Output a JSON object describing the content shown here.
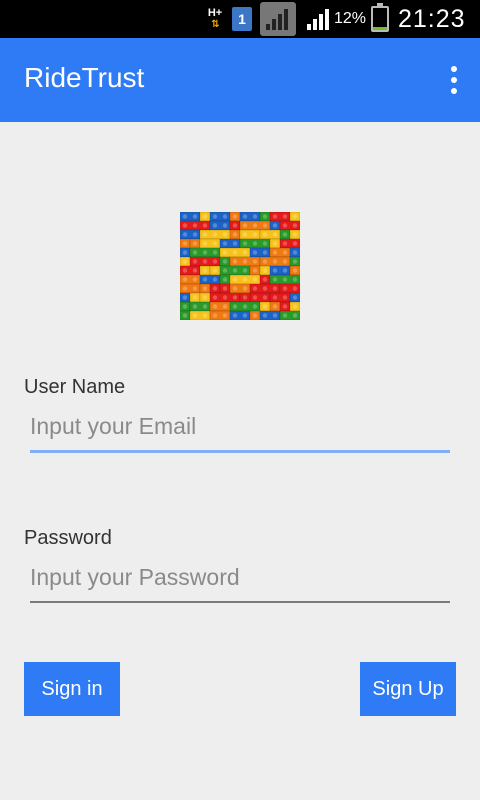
{
  "status_bar": {
    "network_type": "H+",
    "sim_slot": "1",
    "battery_percent": "12%",
    "battery_level": 0.12,
    "time": "21:23"
  },
  "app_bar": {
    "title": "RideTrust",
    "overflow_icon": "more-vert-icon"
  },
  "logo": {
    "icon": "lego-bricks-logo"
  },
  "form": {
    "username_label": "User Name",
    "username_value": "",
    "username_placeholder": "Input your Email",
    "password_label": "Password",
    "password_value": "",
    "password_placeholder": "Input your Password"
  },
  "actions": {
    "sign_in_label": "Sign in",
    "sign_up_label": "Sign Up"
  },
  "colors": {
    "accent": "#2f7bf5",
    "focused_underline": "#7fb0f7",
    "background": "#eeeeee"
  }
}
